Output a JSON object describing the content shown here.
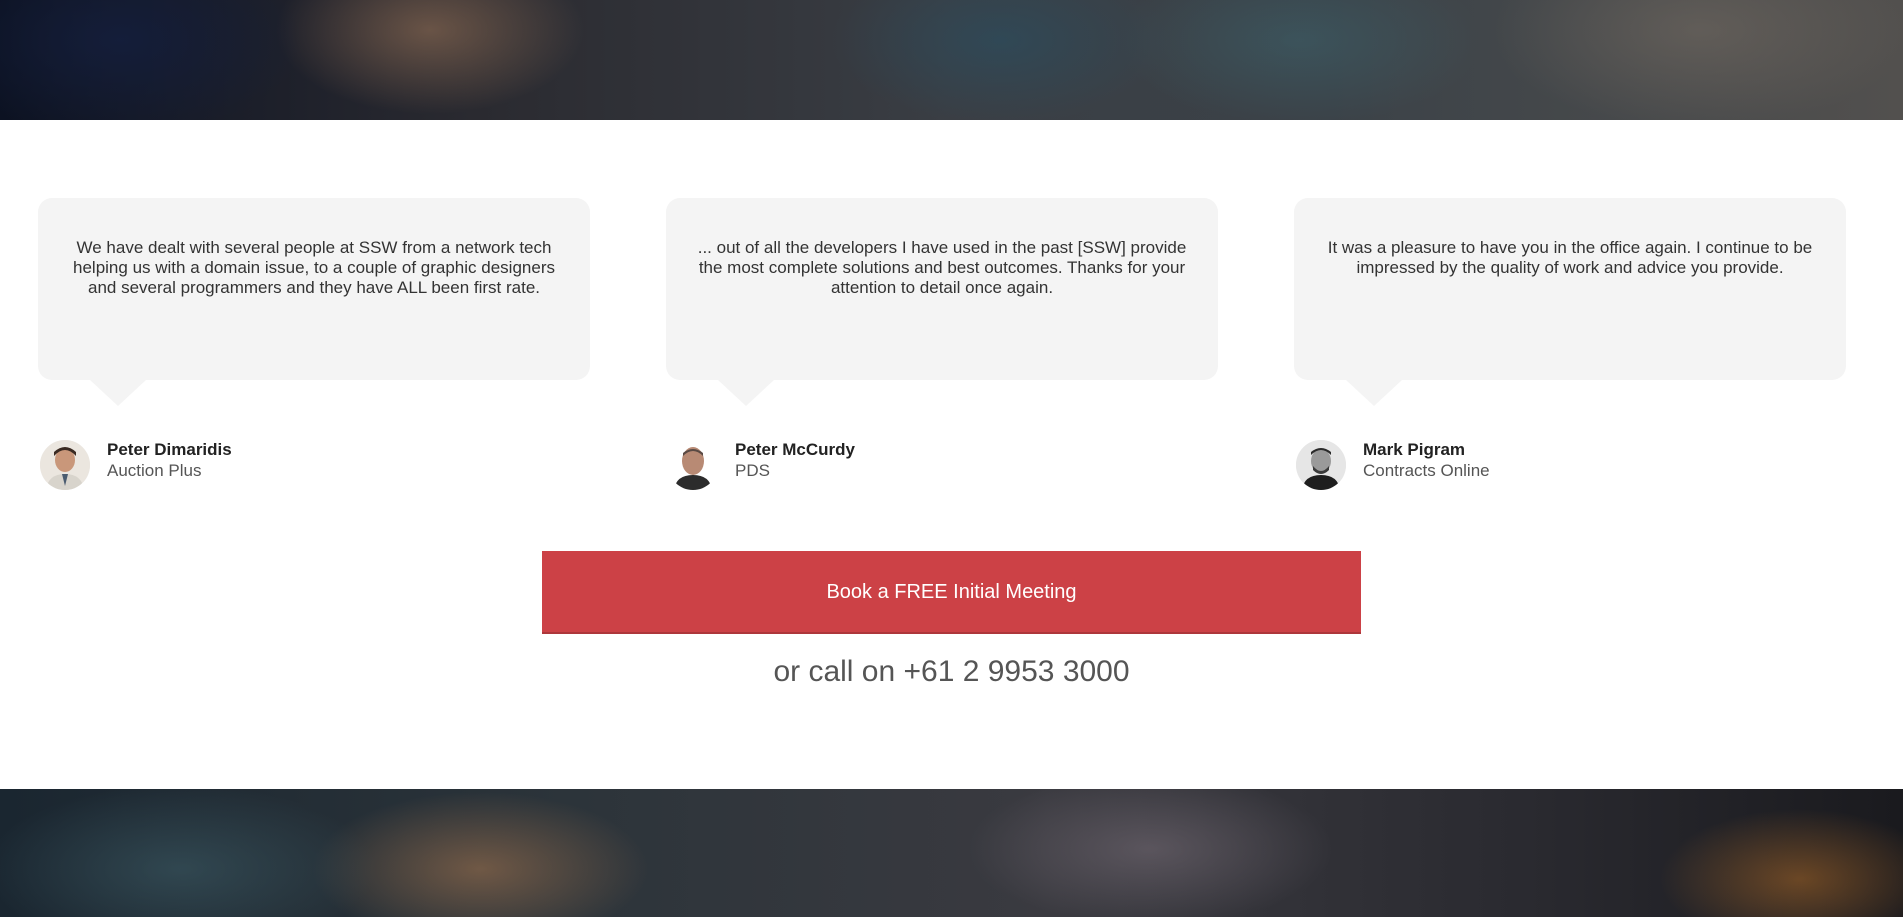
{
  "testimonials": [
    {
      "quote": "We have dealt with several people at SSW from a network tech helping us with a domain issue, to a couple of graphic designers and several programmers and they have ALL been first rate.",
      "name": "Peter Dimaridis",
      "company": "Auction Plus"
    },
    {
      "quote": "... out of all the developers I have used in the past [SSW] provide the most complete solutions and best outcomes. Thanks for your attention to detail once again.",
      "name": "Peter McCurdy",
      "company": "PDS"
    },
    {
      "quote": "It was a pleasure to have you in the office again. I continue to be impressed by the quality of work and advice you provide.",
      "name": "Mark Pigram",
      "company": "Contracts Online"
    }
  ],
  "cta": {
    "button_label": "Book a FREE Initial Meeting",
    "call_text": "or call on +61 2 9953 3000"
  },
  "colors": {
    "accent": "#cc4146",
    "bubble": "#f4f4f4"
  }
}
